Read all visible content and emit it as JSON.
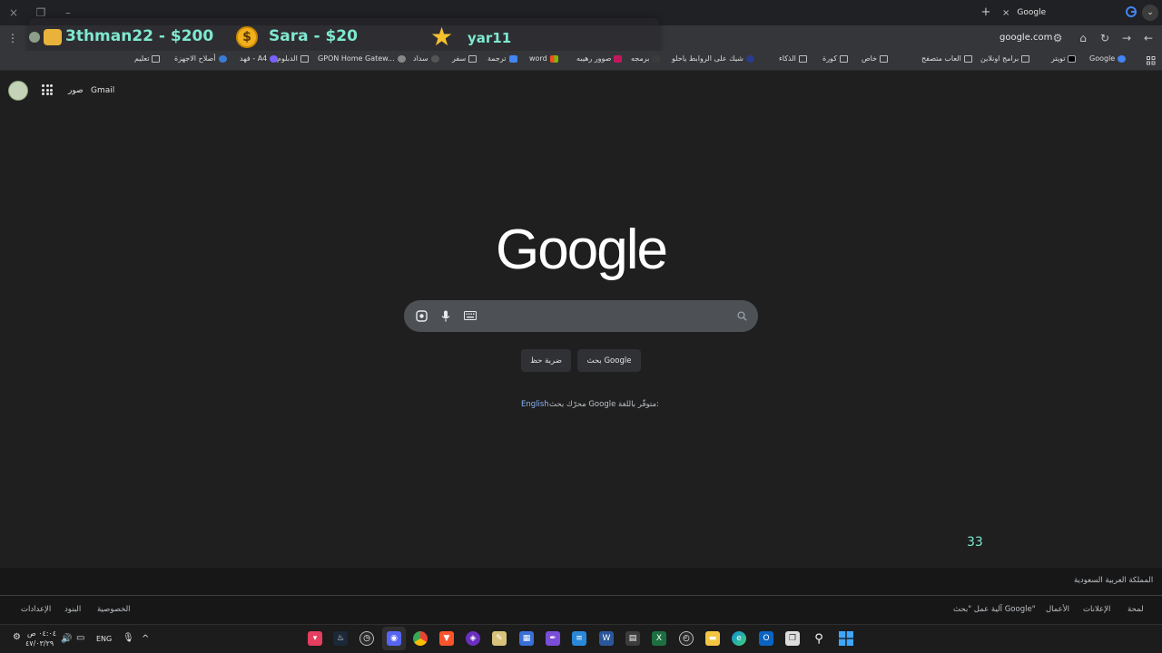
{
  "window": {
    "tab_title": "Google",
    "close_icon": "×",
    "new_tab": "+",
    "minimize": "–",
    "maximize": "❐",
    "dropdown": "⌄"
  },
  "toolbar": {
    "url": "google.com",
    "menu": "⋮",
    "tune": "⚙",
    "home": "⌂",
    "reload": "↻",
    "back": "←",
    "forward": "→"
  },
  "overlay": {
    "donor1": "3thman22 - $200",
    "donor2": "Sara - $20",
    "donor3": "yar11",
    "coin_symbol": "$",
    "star_symbol": "★"
  },
  "bookmarks": [
    {
      "label": "Google",
      "color": "#4285f4"
    },
    {
      "label": "تويتر",
      "color": "#000000"
    },
    {
      "label": "برامج اونلاين",
      "color": ""
    },
    {
      "label": "العاب متصفح",
      "color": ""
    },
    {
      "label": "خاص",
      "color": "#e06ad0"
    },
    {
      "label": "كورة",
      "color": ""
    },
    {
      "label": "الذكاء",
      "color": ""
    },
    {
      "label": "شيك على الروابط ياحلو",
      "color": "#2a3c8a"
    },
    {
      "label": "برمجه",
      "color": "#3b3b3b"
    },
    {
      "label": "صوور رهيبه",
      "color": "#c2185b"
    },
    {
      "label": "word",
      "color": "#f25022"
    },
    {
      "label": "ترجمة",
      "color": "#4285f4"
    },
    {
      "label": "سفر",
      "color": ""
    },
    {
      "label": "سداد",
      "color": "#555555"
    },
    {
      "label": "GPON Home Gatew...",
      "color": "#888888"
    },
    {
      "label": "الدبلوم",
      "color": ""
    },
    {
      "label": "فهد - A4",
      "color": "#7b61ff"
    },
    {
      "label": "أصلاح الاجهزة",
      "color": "#3a7bd5"
    },
    {
      "label": "تعليم",
      "color": ""
    }
  ],
  "google_header": {
    "gmail": "Gmail",
    "images": "صور"
  },
  "logo": "Google",
  "search": {
    "placeholder": "",
    "lens_icon": "◎",
    "mic_icon": "🎤",
    "keyboard_icon": "⌨",
    "search_icon": "⚲"
  },
  "buttons": {
    "google_search": "بحث Google",
    "lucky": "ضربة حظ"
  },
  "language": {
    "text": "محرّك بحث Google متوفّر باللغة:",
    "link": "English"
  },
  "counter": "33",
  "footer": {
    "country": "المملكة العربية السعودية",
    "left_links": [
      "الإعدادات",
      "البنود",
      "الخصوصية"
    ],
    "right_links": [
      "لمحة",
      "الإعلانات",
      "الأعمال",
      "آلية عمل \"بحث Google\""
    ]
  },
  "taskbar": {
    "lang": "ENG",
    "time": "٠٤:٠٤ ص",
    "date": "٤٧/٠٣/٢٩",
    "chevron": "^"
  }
}
